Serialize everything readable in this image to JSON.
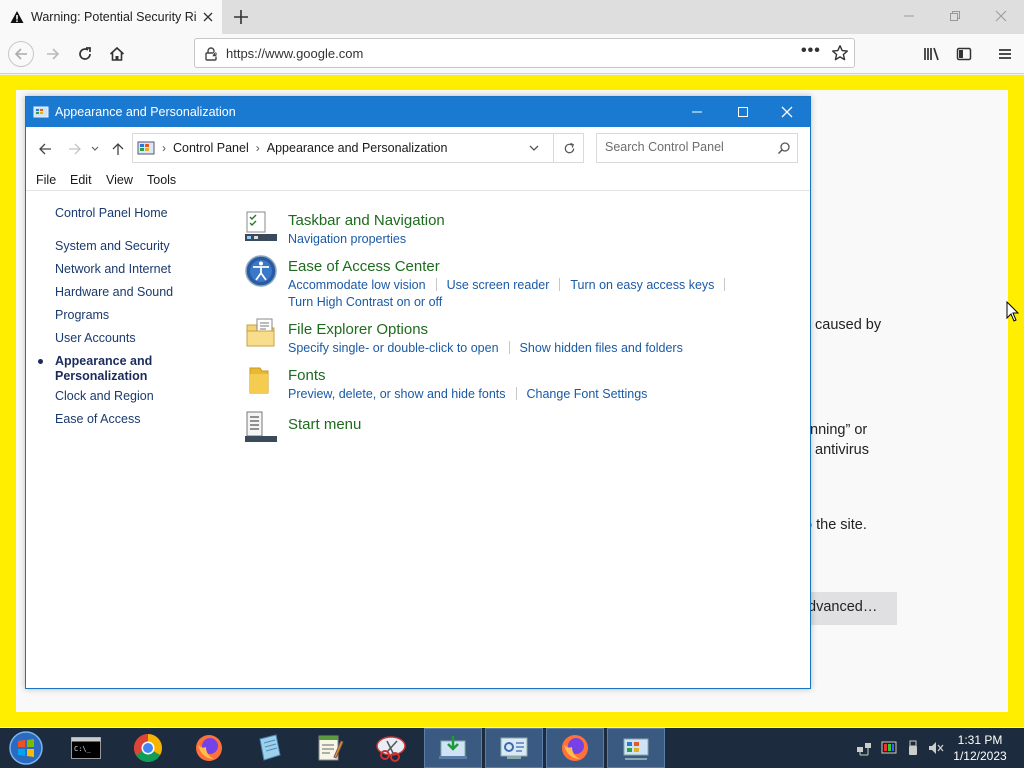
{
  "browser": {
    "tab_title": "Warning: Potential Security Risk Ahead",
    "url": "https://www.google.com",
    "page_fragments": {
      "line1": "caused by",
      "line2": "nning” or",
      "line3": "antivirus",
      "line4": "to the site.",
      "advanced": "dvanced…"
    }
  },
  "control_panel": {
    "title": "Appearance and Personalization",
    "breadcrumb": [
      "Control Panel",
      "Appearance and Personalization"
    ],
    "search_placeholder": "Search Control Panel",
    "menu": [
      "File",
      "Edit",
      "View",
      "Tools"
    ],
    "nav": {
      "home": "Control Panel Home",
      "items": [
        "System and Security",
        "Network and Internet",
        "Hardware and Sound",
        "Programs",
        "User Accounts",
        "Appearance and Personalization",
        "Clock and Region",
        "Ease of Access"
      ],
      "active_label_line1": "Appearance and",
      "active_label_line2": "Personalization"
    },
    "categories": [
      {
        "title": "Taskbar and Navigation",
        "icon": "taskbar-icon",
        "links": [
          "Navigation properties"
        ]
      },
      {
        "title": "Ease of Access Center",
        "icon": "ease-of-access-icon",
        "links": [
          "Accommodate low vision",
          "Use screen reader",
          "Turn on easy access keys",
          "Turn High Contrast on or off"
        ]
      },
      {
        "title": "File Explorer Options",
        "icon": "folder-options-icon",
        "links": [
          "Specify single- or double-click to open",
          "Show hidden files and folders"
        ]
      },
      {
        "title": "Fonts",
        "icon": "fonts-folder-icon",
        "links": [
          "Preview, delete, or show and hide fonts",
          "Change Font Settings"
        ]
      },
      {
        "title": "Start menu",
        "icon": "start-menu-icon",
        "links": []
      }
    ]
  },
  "taskbar": {
    "time": "1:31 PM",
    "date": "1/12/2023"
  },
  "colors": {
    "titlebar": "#1a79d0",
    "category_title": "#1e6b1e",
    "link": "#1a5aa6",
    "page_border": "#ffee00",
    "taskbar": "#1c2b3d"
  }
}
